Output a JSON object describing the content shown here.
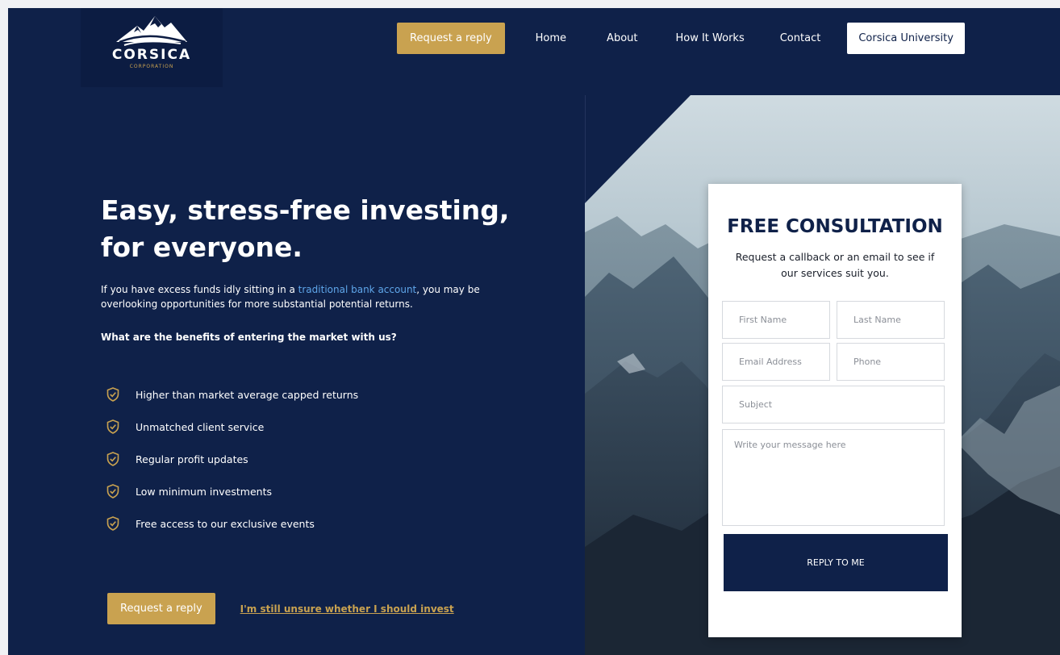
{
  "brand": {
    "name": "CORSICA",
    "sub": "CORPORATION"
  },
  "nav": {
    "cta": "Request a reply",
    "links": [
      "Home",
      "About",
      "How It Works",
      "Contact"
    ],
    "university": "Corsica University"
  },
  "hero": {
    "title_line1": "Easy, stress-free investing,",
    "title_line2": "for everyone.",
    "intro_before": "If you have excess funds idly sitting in a ",
    "intro_link": "traditional bank account",
    "intro_after": ", you may be overlooking opportunities for more substantial potential returns.",
    "benefits_question": "What are the benefits of entering the market with us?",
    "benefits": [
      "Higher than market average capped returns",
      "Unmatched client service",
      "Regular profit updates",
      "Low minimum investments",
      "Free access to our exclusive events"
    ],
    "cta": "Request a reply",
    "unsure_link": "I'm still unsure whether I should invest"
  },
  "form": {
    "title": "FREE CONSULTATION",
    "subtitle": "Request a callback or an email to see if our services suit you.",
    "first_name": "First Name",
    "last_name": "Last Name",
    "email": "Email Address",
    "phone": "Phone",
    "subject": "Subject",
    "message": "Write your message here",
    "submit": "REPLY TO ME"
  },
  "colors": {
    "navy": "#0f2149",
    "gold": "#c9a250",
    "link_blue": "#5fa6ea"
  },
  "icons": {
    "benefit": "shield-check-icon",
    "logo": "mountain-logo-icon"
  }
}
